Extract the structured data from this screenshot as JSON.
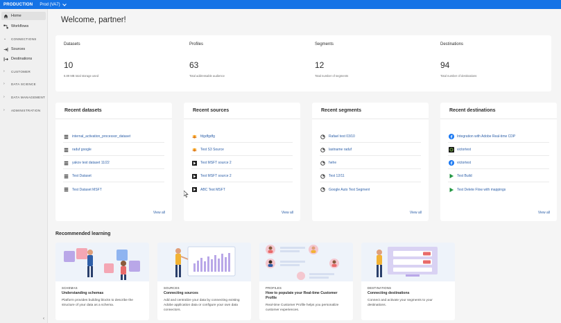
{
  "topbar": {
    "org": "PRODUCTION",
    "sandbox": "Prod (VA7)"
  },
  "sidebar": {
    "items": [
      {
        "label": "Home",
        "icon": "home-icon"
      },
      {
        "label": "Workflows",
        "icon": "workflow-icon"
      },
      {
        "label": "Sources",
        "icon": "sources-icon"
      },
      {
        "label": "Destinations",
        "icon": "destinations-icon"
      }
    ],
    "sections": [
      "CONNECTIONS",
      "CUSTOMER",
      "DATA SCIENCE",
      "DATA MANAGEMENT",
      "ADMINISTRATION"
    ]
  },
  "welcome": "Welcome, partner!",
  "stats": [
    {
      "label": "Datasets",
      "value": "10",
      "sub": "6.89 MB total storage used"
    },
    {
      "label": "Profiles",
      "value": "63",
      "sub": "Total addressable audience"
    },
    {
      "label": "Segments",
      "value": "12",
      "sub": "Total number of segments"
    },
    {
      "label": "Destinations",
      "value": "94",
      "sub": "Total number of destinations"
    }
  ],
  "recent": [
    {
      "title": "Recent datasets",
      "view_all": "View all",
      "rows": [
        "internal_activation_processor_dataset",
        "raduf google",
        "yakov test dataset 11/22",
        "Test Dataset",
        "Test Dataset MSFT"
      ]
    },
    {
      "title": "Recent sources",
      "view_all": "View all",
      "rows": [
        "fdgdfgdfg",
        "Test S3 Source",
        "Test MSFT source 2",
        "Test MSFT source 2",
        "ABC Test MSFT"
      ]
    },
    {
      "title": "Recent segments",
      "view_all": "View all",
      "rows": [
        "Rafael test 03/10",
        "lastname raduf",
        "hehe",
        "Test 12/11",
        "Google Auto Test Segment"
      ]
    },
    {
      "title": "Recent destinations",
      "view_all": "View all",
      "rows": [
        "Integration with Adobe Real-time CDP",
        "victortest",
        "victortest",
        "Test Build",
        "Test Delete Flow with mappings"
      ]
    }
  ],
  "learning": {
    "heading": "Recommended learning",
    "cards": [
      {
        "category": "SCHEMAS",
        "title": "Understanding schemas",
        "desc": "Platform provides building blocks to describe the structure of your data as a schema."
      },
      {
        "category": "SOURCES",
        "title": "Connecting sources",
        "desc": "Add and centralize your data by connecting existing Adobe application data or configure your own data connectors."
      },
      {
        "category": "PROFILES",
        "title": "How to populate your Real-time Customer Profile",
        "desc": "Real-time Customer Profile helps you personalize customer experiences."
      },
      {
        "category": "DESTINATIONS",
        "title": "Connecting destinations",
        "desc": "Connect and activate your segments to your destinations."
      }
    ]
  },
  "colors": {
    "topbar": "#1473e6",
    "link": "#2c5fa8"
  }
}
